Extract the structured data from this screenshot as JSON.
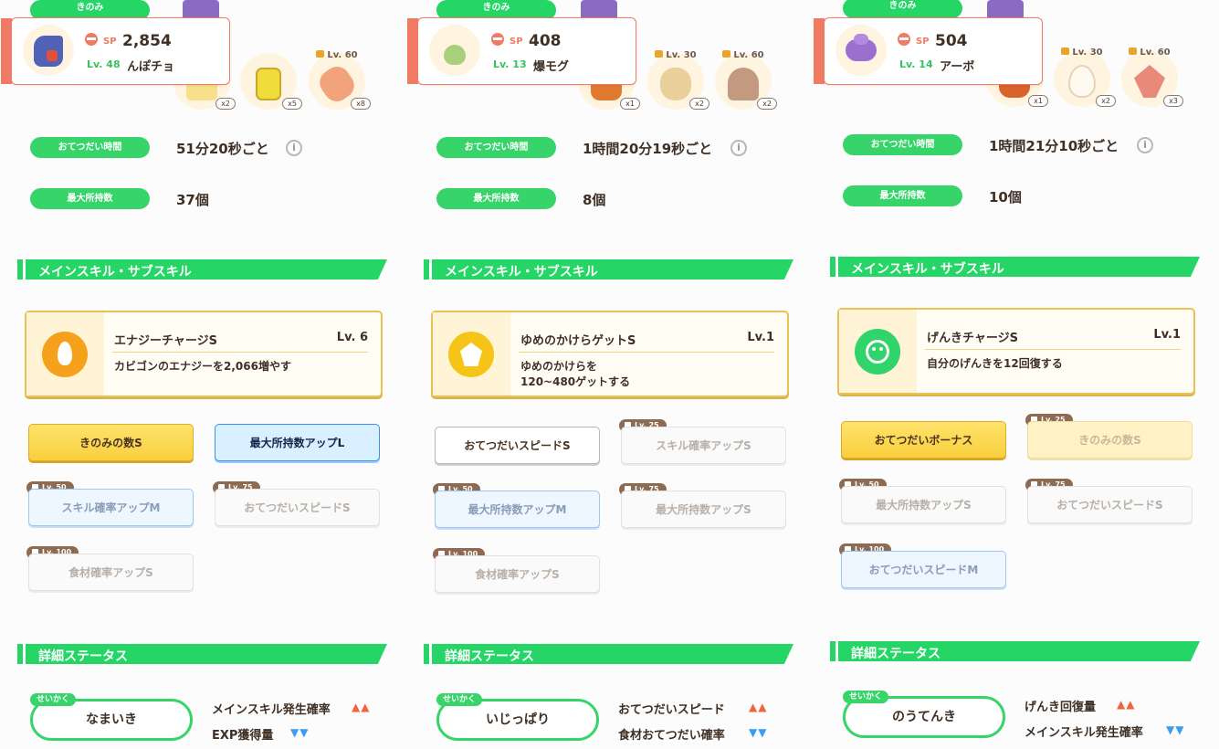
{
  "colors": {
    "accent_green": "#25d667",
    "sp_red": "#f07a63",
    "gold": "#f8cf3e",
    "blue": "#3d8fe8"
  },
  "panels": [
    {
      "berry_label": "きのみ",
      "pokemon": {
        "icon": "garchomp-icon",
        "sp_label": "SP",
        "sp_value": "2,854",
        "level": "Lv. 48",
        "name": "んぽチョ"
      },
      "ingredients": [
        {
          "icon": "honey-jar-icon",
          "count": "x2",
          "unlock": ""
        },
        {
          "icon": "oil-bottle-icon",
          "count": "x5",
          "unlock": ""
        },
        {
          "icon": "potato-icon",
          "count": "x8",
          "unlock": "Lv. 60"
        }
      ],
      "help_time_label": "おてつだい時間",
      "help_time_value": "51分20秒ごと",
      "max_carry_label": "最大所持数",
      "max_carry_value": "37個",
      "skills_header": "メインスキル・サブスキル",
      "main_skill": {
        "icon": "flame-icon",
        "icon_color": "#f5a11c",
        "name": "エナジーチャージS",
        "level": "Lv. 6",
        "desc": "カビゴンのエナジーを2,066増やす"
      },
      "subskills": [
        {
          "label": "きのみの数S",
          "style": "gold",
          "unlock": ""
        },
        {
          "label": "最大所持数アップL",
          "style": "blue",
          "unlock": ""
        },
        {
          "label": "スキル確率アップM",
          "style": "lockblue",
          "unlock": "Lv. 50"
        },
        {
          "label": "おてつだいスピードS",
          "style": "lockwhite",
          "unlock": "Lv. 75"
        },
        {
          "label": "食材確率アップS",
          "style": "lockwhite",
          "unlock": "Lv. 100"
        }
      ],
      "details_header": "詳細ステータス",
      "nature_tag": "せいかく",
      "nature": "なまいき",
      "effects": [
        {
          "label": "メインスキル発生確率",
          "arrows": "▲▲",
          "dir": "up"
        },
        {
          "label": "EXP獲得量",
          "arrows": "▼▼",
          "dir": "down"
        }
      ]
    },
    {
      "berry_label": "きのみ",
      "pokemon": {
        "icon": "sprout-icon",
        "sp_label": "SP",
        "sp_value": "408",
        "level": "Lv. 13",
        "name": "爆モグ"
      },
      "ingredients": [
        {
          "icon": "mushroom-icon",
          "count": "x1",
          "unlock": ""
        },
        {
          "icon": "soybean-icon",
          "count": "x2",
          "unlock": "Lv. 30"
        },
        {
          "icon": "mushroom-icon",
          "count": "x2",
          "unlock": "Lv. 60"
        }
      ],
      "help_time_label": "おてつだい時間",
      "help_time_value": "1時間20分19秒ごと",
      "max_carry_label": "最大所持数",
      "max_carry_value": "8個",
      "skills_header": "メインスキル・サブスキル",
      "main_skill": {
        "icon": "dream-shard-icon",
        "icon_color": "#f6c417",
        "name": "ゆめのかけらゲットS",
        "level": "Lv.1",
        "desc": "ゆめのかけらを\n120~480ゲットする"
      },
      "subskills": [
        {
          "label": "おてつだいスピードS",
          "style": "white",
          "unlock": ""
        },
        {
          "label": "スキル確率アップS",
          "style": "lockwhite",
          "unlock": "Lv. 25"
        },
        {
          "label": "最大所持数アップM",
          "style": "lockblue",
          "unlock": "Lv. 50"
        },
        {
          "label": "最大所持数アップS",
          "style": "lockwhite",
          "unlock": "Lv. 75"
        },
        {
          "label": "食材確率アップS",
          "style": "lockwhite",
          "unlock": "Lv. 100"
        }
      ],
      "details_header": "詳細ステータス",
      "nature_tag": "せいかく",
      "nature": "いじっぱり",
      "effects": [
        {
          "label": "おてつだいスピード",
          "arrows": "▲▲",
          "dir": "up"
        },
        {
          "label": "食材おてつだい確率",
          "arrows": "▼▼",
          "dir": "down"
        }
      ]
    },
    {
      "berry_label": "きのみ",
      "pokemon": {
        "icon": "ekans-icon",
        "sp_label": "SP",
        "sp_value": "504",
        "level": "Lv. 14",
        "name": "アーボ"
      },
      "ingredients": [
        {
          "icon": "sausage-icon",
          "count": "x1",
          "unlock": ""
        },
        {
          "icon": "egg-icon",
          "count": "x2",
          "unlock": "Lv. 30"
        },
        {
          "icon": "herb-icon",
          "count": "x3",
          "unlock": "Lv. 60"
        }
      ],
      "help_time_label": "おてつだい時間",
      "help_time_value": "1時間21分10秒ごと",
      "max_carry_label": "最大所持数",
      "max_carry_value": "10個",
      "skills_header": "メインスキル・サブスキル",
      "main_skill": {
        "icon": "smile-icon",
        "icon_color": "#2fd46a",
        "name": "げんきチャージS",
        "level": "Lv.1",
        "desc": "自分のげんきを12回復する"
      },
      "subskills": [
        {
          "label": "おてつだいボーナス",
          "style": "gold",
          "unlock": ""
        },
        {
          "label": "きのみの数S",
          "style": "lockgold",
          "unlock": "Lv. 25"
        },
        {
          "label": "最大所持数アップS",
          "style": "lockwhite",
          "unlock": "Lv. 50"
        },
        {
          "label": "おてつだいスピードS",
          "style": "lockwhite",
          "unlock": "Lv. 75"
        },
        {
          "label": "おてつだいスピードM",
          "style": "lockblue",
          "unlock": "Lv. 100"
        }
      ],
      "details_header": "詳細ステータス",
      "nature_tag": "せいかく",
      "nature": "のうてんき",
      "effects": [
        {
          "label": "げんき回復量",
          "arrows": "▲▲",
          "dir": "up"
        },
        {
          "label": "メインスキル発生確率",
          "arrows": "▼▼",
          "dir": "down"
        }
      ]
    }
  ]
}
